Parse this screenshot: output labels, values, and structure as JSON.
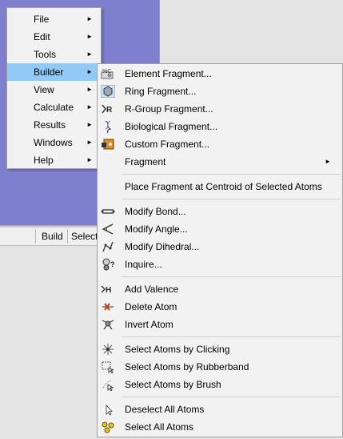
{
  "main_menu": {
    "items": [
      {
        "label": "File",
        "has_submenu": true,
        "active": false
      },
      {
        "label": "Edit",
        "has_submenu": true,
        "active": false
      },
      {
        "label": "Tools",
        "has_submenu": true,
        "active": false
      },
      {
        "label": "Builder",
        "has_submenu": true,
        "active": true
      },
      {
        "label": "View",
        "has_submenu": true,
        "active": false
      },
      {
        "label": "Calculate",
        "has_submenu": true,
        "active": false
      },
      {
        "label": "Results",
        "has_submenu": true,
        "active": false
      },
      {
        "label": "Windows",
        "has_submenu": true,
        "active": false
      },
      {
        "label": "Help",
        "has_submenu": true,
        "active": false
      }
    ],
    "arrow_glyph": "►"
  },
  "builder_submenu": {
    "groups": [
      [
        {
          "label": "Element Fragment...",
          "icon": "element-fragment-icon"
        },
        {
          "label": "Ring Fragment...",
          "icon": "ring-fragment-icon"
        },
        {
          "label": "R-Group Fragment...",
          "icon": "rgroup-fragment-icon"
        },
        {
          "label": "Biological Fragment...",
          "icon": "biological-fragment-icon"
        },
        {
          "label": "Custom Fragment...",
          "icon": "custom-fragment-icon"
        },
        {
          "label": "Fragment",
          "icon": "",
          "has_submenu": true
        }
      ],
      [
        {
          "label": "Place Fragment at Centroid of Selected Atoms",
          "icon": ""
        }
      ],
      [
        {
          "label": "Modify Bond...",
          "icon": "modify-bond-icon"
        },
        {
          "label": "Modify Angle...",
          "icon": "modify-angle-icon"
        },
        {
          "label": "Modify Dihedral...",
          "icon": "modify-dihedral-icon"
        },
        {
          "label": "Inquire...",
          "icon": "inquire-icon"
        }
      ],
      [
        {
          "label": "Add Valence",
          "icon": "add-valence-icon"
        },
        {
          "label": "Delete Atom",
          "icon": "delete-atom-icon"
        },
        {
          "label": "Invert Atom",
          "icon": "invert-atom-icon"
        }
      ],
      [
        {
          "label": "Select Atoms by Clicking",
          "icon": "select-click-icon"
        },
        {
          "label": "Select Atoms by Rubberband",
          "icon": "select-rubberband-icon"
        },
        {
          "label": "Select Atoms by Brush",
          "icon": "select-brush-icon"
        }
      ],
      [
        {
          "label": "Deselect All Atoms",
          "icon": "deselect-all-icon"
        },
        {
          "label": "Select All Atoms",
          "icon": "select-all-icon"
        }
      ]
    ]
  },
  "statusbar": {
    "cells": [
      "Build",
      "Select"
    ]
  },
  "colors": {
    "canvas_bg": "#7f7fd0",
    "menu_bg": "#f2f2f2",
    "highlight": "#91c9f7"
  }
}
